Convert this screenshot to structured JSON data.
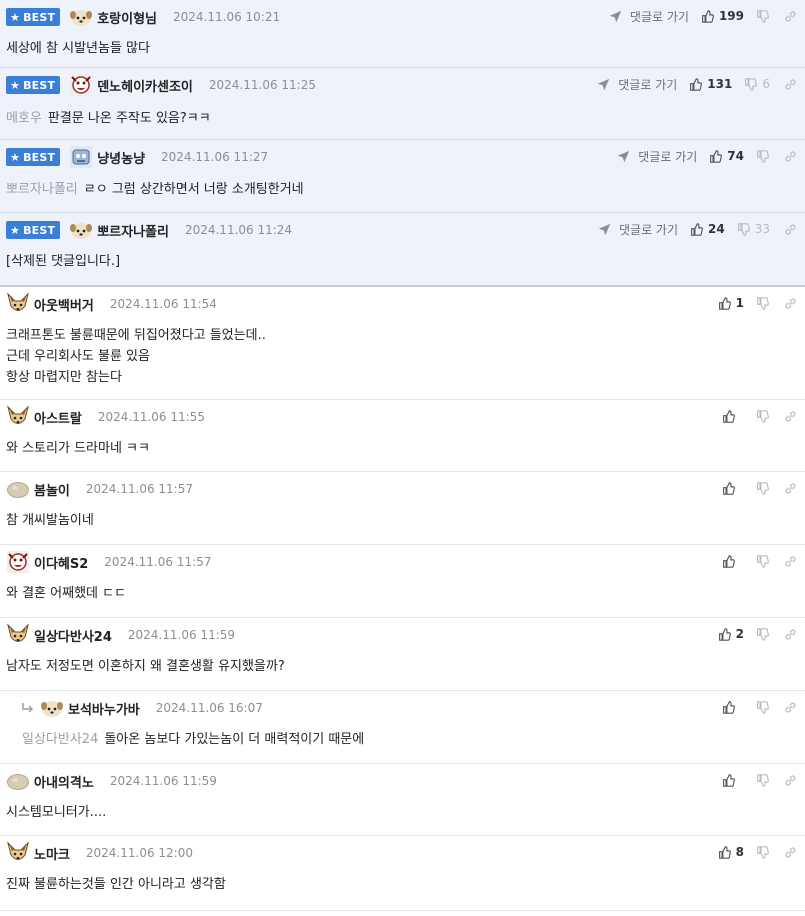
{
  "labels": {
    "best": "BEST",
    "reply_link": "댓글로 가기"
  },
  "icons": {
    "best_star": "star-icon",
    "reply_link": "paper-plane-icon",
    "like": "thumbs-up-icon",
    "dislike": "thumbs-down-icon",
    "share": "link-icon",
    "reply_marker": "reply-arrow-icon"
  },
  "colors": {
    "best_badge": "#3a7ed8",
    "best_background": "#eef3fb",
    "separator": "#e3e6ea",
    "date_text": "#8a8f96",
    "quote_text": "#9aa0a8"
  },
  "comments": [
    {
      "best": true,
      "avatar": "puppy",
      "nick": "호랑이형님",
      "date": "2024.11.06 10:21",
      "like": "199",
      "dislike": "",
      "reply_link": true,
      "quote": "",
      "text": "세상에 참 시발년놈들 많다"
    },
    {
      "best": true,
      "avatar": "clown",
      "nick": "덴노헤이카센조이",
      "date": "2024.11.06 11:25",
      "like": "131",
      "dislike": "6",
      "reply_link": true,
      "quote": "메호우",
      "text": "판결문 나온 주작도 있음?ㅋㅋ"
    },
    {
      "best": true,
      "avatar": "robot",
      "nick": "냥녕농냥",
      "date": "2024.11.06 11:27",
      "like": "74",
      "dislike": "",
      "reply_link": true,
      "quote": "뽀르자나폴리",
      "text": "ㄹㅇ 그럼 상간하면서 너랑 소개팅한거네"
    },
    {
      "best": true,
      "avatar": "puppy",
      "nick": "뽀르자나폴리",
      "date": "2024.11.06 11:24",
      "like": "24",
      "dislike": "33",
      "reply_link": true,
      "quote": "",
      "text": "[삭제된 댓글입니다.]"
    },
    {
      "best": false,
      "avatar": "fox",
      "nick": "아웃백버거",
      "date": "2024.11.06 11:54",
      "like": "1",
      "dislike": "",
      "reply_link": false,
      "quote": "",
      "text": "크래프톤도 불륜때문에 뒤집어졌다고 들었는데..\n근데 우리회사도 불륜 있음\n항상 마렵지만 참는다"
    },
    {
      "best": false,
      "avatar": "fox",
      "nick": "아스트랄",
      "date": "2024.11.06 11:55",
      "like": "",
      "dislike": "",
      "reply_link": false,
      "quote": "",
      "text": "와 스토리가 드라마네 ㅋㅋ"
    },
    {
      "best": false,
      "avatar": "blob",
      "nick": "봄놀이",
      "date": "2024.11.06 11:57",
      "like": "",
      "dislike": "",
      "reply_link": false,
      "quote": "",
      "text": "참 개씨발놈이네"
    },
    {
      "best": false,
      "avatar": "clown",
      "nick": "이다혜S2",
      "date": "2024.11.06 11:57",
      "like": "",
      "dislike": "",
      "reply_link": false,
      "quote": "",
      "text": "와 결혼 어째했데 ㄷㄷ"
    },
    {
      "best": false,
      "avatar": "fox",
      "nick": "일상다반사24",
      "date": "2024.11.06 11:59",
      "like": "2",
      "dislike": "",
      "reply_link": false,
      "quote": "",
      "text": "남자도 저정도면 이혼하지 왜 결혼생활 유지했을까?"
    },
    {
      "best": false,
      "reply": true,
      "avatar": "puppy",
      "nick": "보석바누가바",
      "date": "2024.11.06 16:07",
      "like": "",
      "dislike": "",
      "reply_link": false,
      "quote": "일상다반사24",
      "text": "돌아온 놈보다 가있는놈이 더 매력적이기 때문에"
    },
    {
      "best": false,
      "avatar": "blob",
      "nick": "아내의격노",
      "date": "2024.11.06 11:59",
      "like": "",
      "dislike": "",
      "reply_link": false,
      "quote": "",
      "text": "시스템모니터가...."
    },
    {
      "best": false,
      "avatar": "fox",
      "nick": "노마크",
      "date": "2024.11.06 12:00",
      "like": "8",
      "dislike": "",
      "reply_link": false,
      "quote": "",
      "text": "진짜 불륜하는것들 인간 아니라고 생각함"
    }
  ]
}
